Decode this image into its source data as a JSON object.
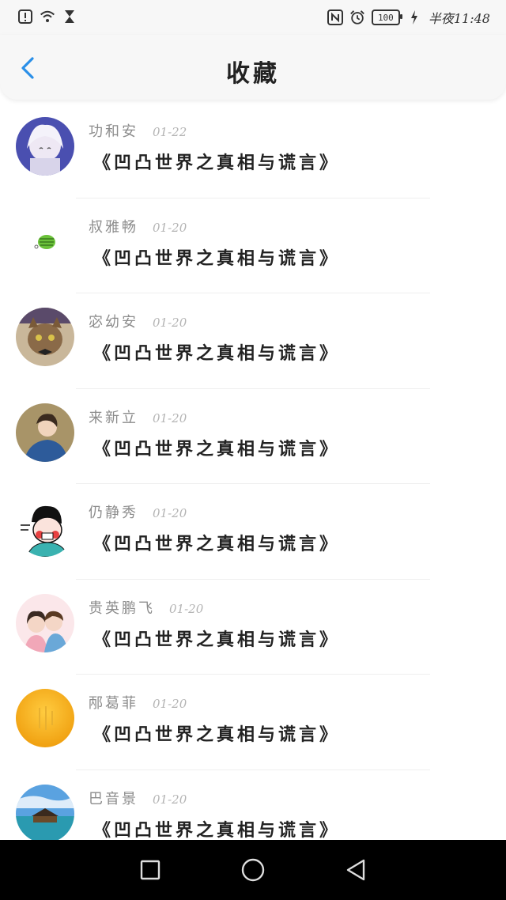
{
  "status_bar": {
    "left_icons": [
      "alert-icon",
      "wifi-icon",
      "hourglass-icon"
    ],
    "right_icons": [
      "nfc-icon",
      "alarm-icon"
    ],
    "battery": "100",
    "time": "半夜11:48"
  },
  "header": {
    "title": "收藏",
    "back_icon": "chevron-left-icon"
  },
  "favorites": [
    {
      "name": "功和安",
      "date": "01-22",
      "book": "《凹凸世界之真相与谎言》",
      "avatar": "anime-avatar"
    },
    {
      "name": "叔雅畅",
      "date": "01-20",
      "book": "《凹凸世界之真相与谎言》",
      "avatar": "green-sticker-avatar"
    },
    {
      "name": "宓幼安",
      "date": "01-20",
      "book": "《凹凸世界之真相与谎言》",
      "avatar": "cat-avatar"
    },
    {
      "name": "来新立",
      "date": "01-20",
      "book": "《凹凸世界之真相与谎言》",
      "avatar": "photo-avatar"
    },
    {
      "name": "仍静秀",
      "date": "01-20",
      "book": "《凹凸世界之真相与谎言》",
      "avatar": "cartoon-avatar"
    },
    {
      "name": "贵英鹏飞",
      "date": "01-20",
      "book": "《凹凸世界之真相与谎言》",
      "avatar": "couple-avatar"
    },
    {
      "name": "邴葛菲",
      "date": "01-20",
      "book": "《凹凸世界之真相与谎言》",
      "avatar": "orange-avatar"
    },
    {
      "name": "巴音景",
      "date": "01-20",
      "book": "《凹凸世界之真相与谎言》",
      "avatar": "sea-avatar"
    }
  ],
  "nav_bar": {
    "icons": [
      "recents-square-icon",
      "home-circle-icon",
      "back-triangle-icon"
    ]
  },
  "colors": {
    "accent": "#2a8fe8",
    "name_text": "#8c8c8c",
    "date_text": "#b4b4b4",
    "title_text": "#222222"
  }
}
